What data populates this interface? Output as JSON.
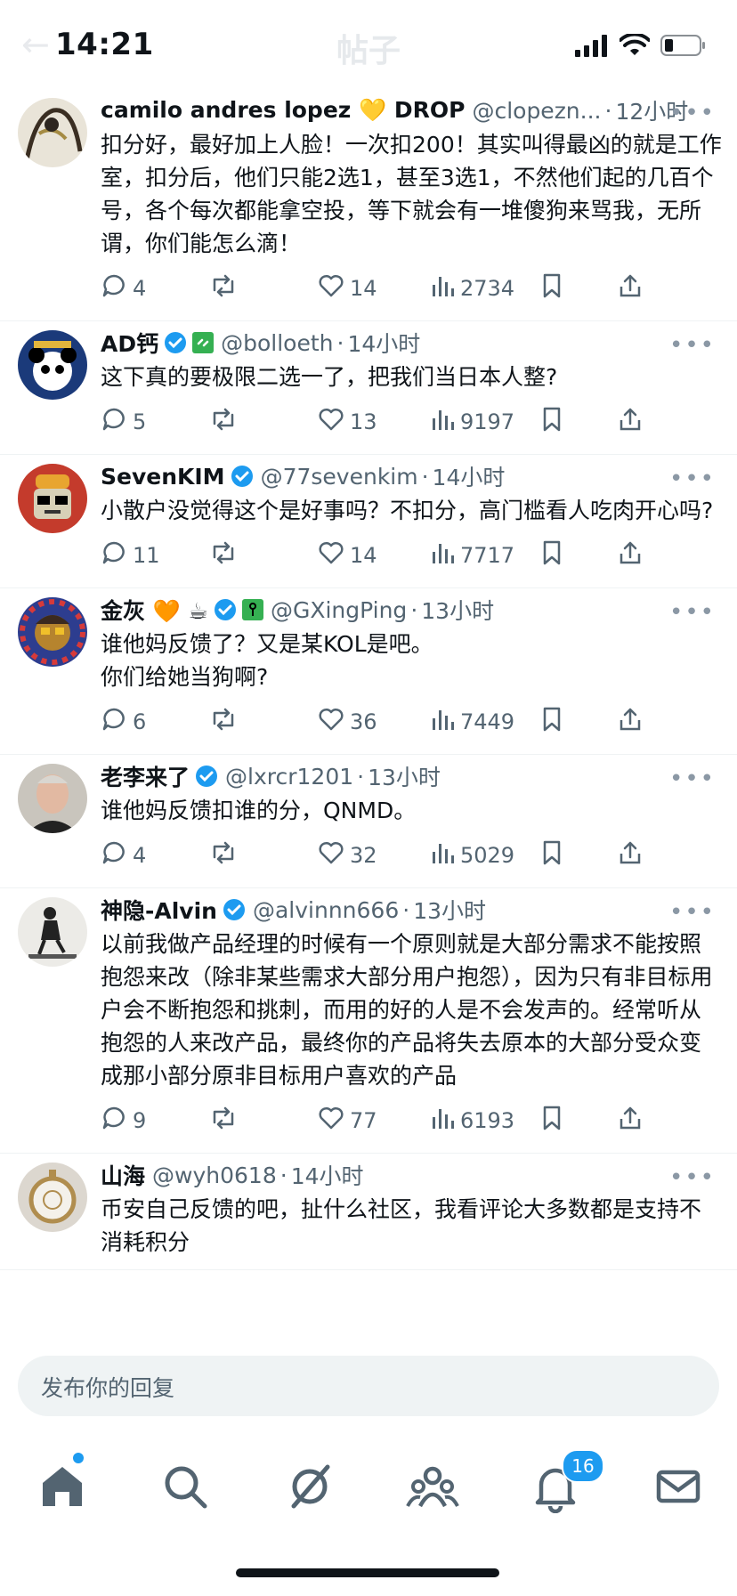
{
  "status_bar": {
    "time": "14:21",
    "battery_level": 0.25
  },
  "header": {
    "title": "帖子"
  },
  "posts": [
    {
      "name": "camilo andres lopez 💛 DROP",
      "handle": "@clopezn...",
      "dot": "·",
      "ago": "12小时",
      "verified": false,
      "text": "扣分好，最好加上人脸！一次扣200！其实叫得最凶的就是工作室，扣分后，他们只能2选1，甚至3选1，不然他们起的几百个号，各个每次都能拿空投，等下就会有一堆傻狗来骂我，无所谓，你们能怎么滴！",
      "replies": "4",
      "likes": "14",
      "views": "2734",
      "avatar": "sketch"
    },
    {
      "name": "AD钙",
      "handle": "@bolloeth",
      "dot": "·",
      "ago": "14小时",
      "verified": true,
      "text": "这下真的要极限二选一了，把我们当日本人整?",
      "replies": "5",
      "likes": "13",
      "views": "9197",
      "avatar": "panda"
    },
    {
      "name": "SevenKIM",
      "handle": "@77sevenkim",
      "dot": "·",
      "ago": "14小时",
      "verified": true,
      "text": "小散户没觉得这个是好事吗？不扣分，高门槛看人吃肉开心吗?",
      "replies": "11",
      "likes": "14",
      "views": "7717",
      "avatar": "robot"
    },
    {
      "name": "金灰 🧡 ☕",
      "handle": "@GXingPing",
      "dot": "·",
      "ago": "13小时",
      "verified": true,
      "text": "谁他妈反馈了？又是某KOL是吧。\n你们给她当狗啊?",
      "replies": "6",
      "likes": "36",
      "views": "7449",
      "avatar": "face"
    },
    {
      "name": "老李来了",
      "handle": "@lxrcr1201",
      "dot": "·",
      "ago": "13小时",
      "verified": true,
      "text": "谁他妈反馈扣谁的分，QNMD。",
      "replies": "4",
      "likes": "32",
      "views": "5029",
      "avatar": "man"
    },
    {
      "name": "神隐-Alvin",
      "handle": "@alvinnn666",
      "dot": "·",
      "ago": "13小时",
      "verified": true,
      "text": "以前我做产品经理的时候有一个原则就是大部分需求不能按照抱怨来改（除非某些需求大部分用户抱怨），因为只有非目标用户会不断抱怨和挑刺，而用的好的人是不会发声的。经常听从抱怨的人来改产品，最终你的产品将失去原本的大部分受众变成那小部分原非目标用户喜欢的产品",
      "replies": "9",
      "likes": "77",
      "views": "6193",
      "avatar": "figure"
    },
    {
      "name": "山海",
      "handle": "@wyh0618",
      "dot": "·",
      "ago": "14小时",
      "verified": false,
      "text": "币安自己反馈的吧，扯什么社区，我看评论大多数都是支持不消耗积分",
      "replies": "",
      "likes": "",
      "views": "",
      "avatar": "watch"
    }
  ],
  "composer": {
    "placeholder": "发布你的回复"
  },
  "tabbar": {
    "items": [
      "home-icon",
      "search-icon",
      "grok-icon",
      "communities-icon",
      "notifications-icon",
      "messages-icon"
    ],
    "notifications_count": "16"
  },
  "colors": {
    "accent": "#1d9bf0",
    "muted": "#536471"
  }
}
